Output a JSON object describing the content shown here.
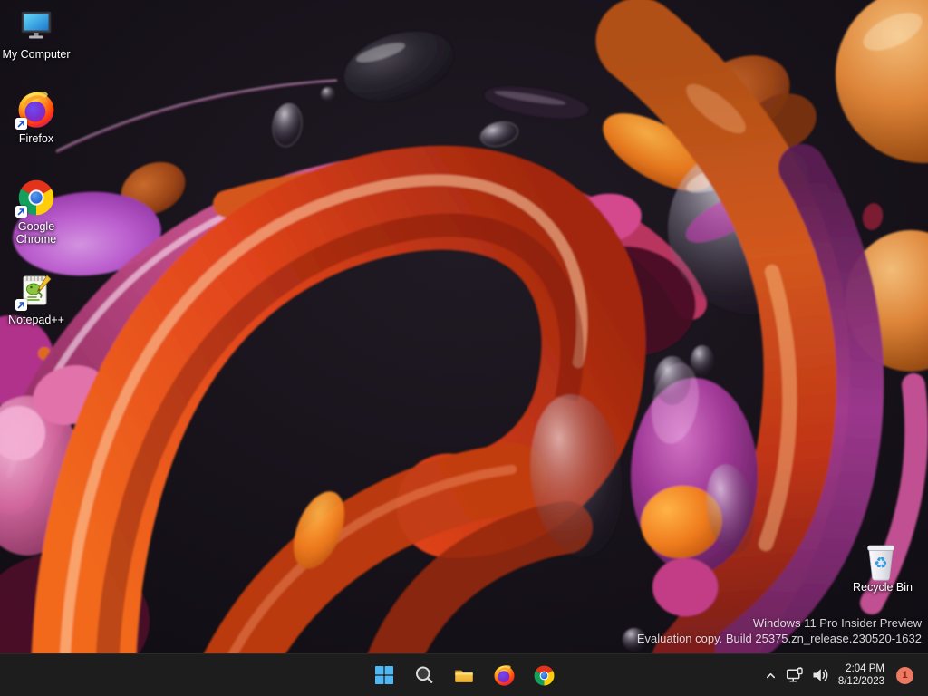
{
  "desktop": {
    "icons": [
      {
        "id": "my-computer",
        "label": "My Computer",
        "shortcut": false
      },
      {
        "id": "firefox",
        "label": "Firefox",
        "shortcut": true
      },
      {
        "id": "google-chrome",
        "label": "Google Chrome",
        "shortcut": true
      },
      {
        "id": "notepad-plus-plus",
        "label": "Notepad++",
        "shortcut": true
      },
      {
        "id": "recycle-bin",
        "label": "Recycle Bin",
        "shortcut": false
      }
    ],
    "watermark": {
      "line1": "Windows 11 Pro Insider Preview",
      "line2": "Evaluation copy. Build 25375.zn_release.230520-1632"
    }
  },
  "taskbar": {
    "buttons": [
      {
        "id": "start",
        "icon": "windows-logo-icon"
      },
      {
        "id": "search",
        "icon": "search-icon"
      },
      {
        "id": "file-explorer",
        "icon": "folder-icon"
      },
      {
        "id": "firefox",
        "icon": "firefox-icon"
      },
      {
        "id": "chrome",
        "icon": "chrome-icon"
      }
    ],
    "tray": {
      "icons": [
        "chevron-up-icon",
        "network-icon",
        "volume-icon"
      ],
      "time": "2:04 PM",
      "date": "8/12/2023",
      "notification_count": "1"
    }
  },
  "colors": {
    "taskbar_bg": "#1d1d1d",
    "accent_blue": "#4fb8f2",
    "badge_bg": "#ec7962",
    "badge_text": "#8c2417",
    "label_text": "#ffffff"
  }
}
